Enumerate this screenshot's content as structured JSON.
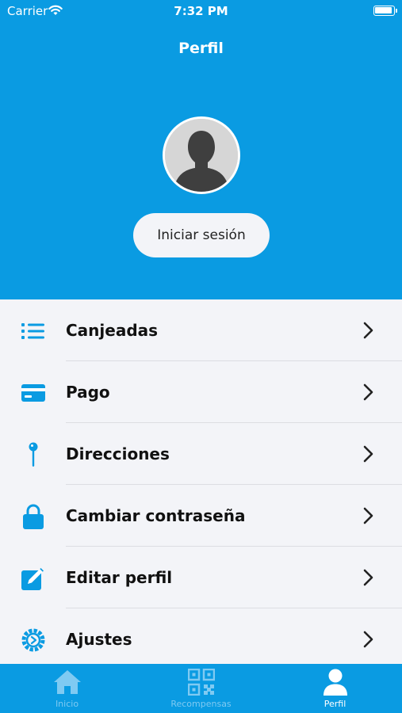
{
  "status_bar": {
    "carrier": "Carrier",
    "time": "7:32 PM"
  },
  "header": {
    "title": "Perfil",
    "login_label": "Iniciar sesión"
  },
  "colors": {
    "primary": "#0a9be2",
    "background": "#f3f4f8",
    "tab_inactive": "#7fcaf2"
  },
  "menu": {
    "items": [
      {
        "label": "Canjeadas",
        "icon": "list-icon"
      },
      {
        "label": "Pago",
        "icon": "credit-card-icon"
      },
      {
        "label": "Direcciones",
        "icon": "pin-icon"
      },
      {
        "label": "Cambiar contraseña",
        "icon": "lock-icon"
      },
      {
        "label": "Editar perfil",
        "icon": "edit-icon"
      },
      {
        "label": "Ajustes",
        "icon": "settings-icon"
      }
    ]
  },
  "tabbar": {
    "items": [
      {
        "label": "Inicio",
        "icon": "home-icon",
        "active": false
      },
      {
        "label": "Recompensas",
        "icon": "qr-code-icon",
        "active": false
      },
      {
        "label": "Perfil",
        "icon": "user-icon",
        "active": true
      }
    ]
  }
}
